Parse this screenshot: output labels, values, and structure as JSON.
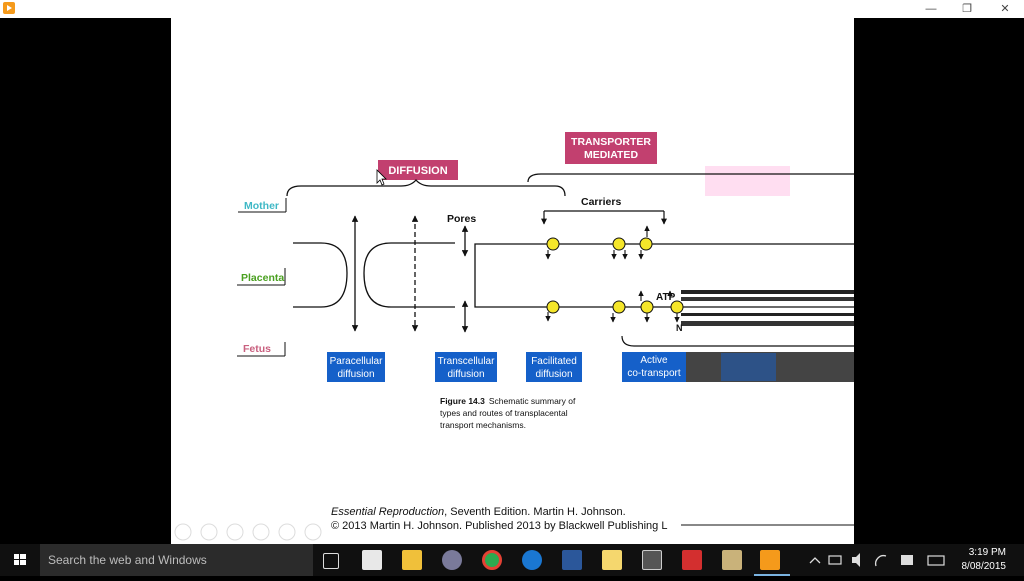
{
  "window": {
    "minimize_glyph": "—",
    "restore_glyph": "❐",
    "close_glyph": "✕"
  },
  "diagram": {
    "header_diffusion": "DIFFUSION",
    "header_transporter_line1": "TRANSPORTER",
    "header_transporter_line2": "MEDIATED",
    "label_mother": "Mother",
    "label_placenta": "Placenta",
    "label_fetus": "Fetus",
    "label_pores": "Pores",
    "label_carriers": "Carriers",
    "label_atp": "ATP",
    "box_paracellular_1": "Paracellular",
    "box_paracellular_2": "diffusion",
    "box_transcellular_1": "Transcellular",
    "box_transcellular_2": "diffusion",
    "box_facilitated_1": "Facilitated",
    "box_facilitated_2": "diffusion",
    "box_active_1": "Active",
    "box_active_2": "co-transport",
    "caption_fig": "Figure 14.3",
    "caption_line1": "Schematic summary of",
    "caption_line2": "types and routes of transplacental",
    "caption_line3": "transport mechanisms.",
    "credit_title": "Essential Reproduction",
    "credit_rest": ", Seventh Edition. Martin H. Johnson.",
    "credit_line2": "© 2013 Martin H. Johnson. Published 2013 by Blackwell Publishing L",
    "colors": {
      "magenta": "#c2406f",
      "blue": "#1560c9",
      "mother": "#3fb8c6",
      "placenta": "#4aa020",
      "fetus": "#c9607f",
      "carrier": "#f5e62a"
    }
  },
  "taskbar": {
    "search_placeholder": "Search the web and Windows",
    "clock_time": "3:19 PM",
    "clock_date": "8/08/2015"
  }
}
